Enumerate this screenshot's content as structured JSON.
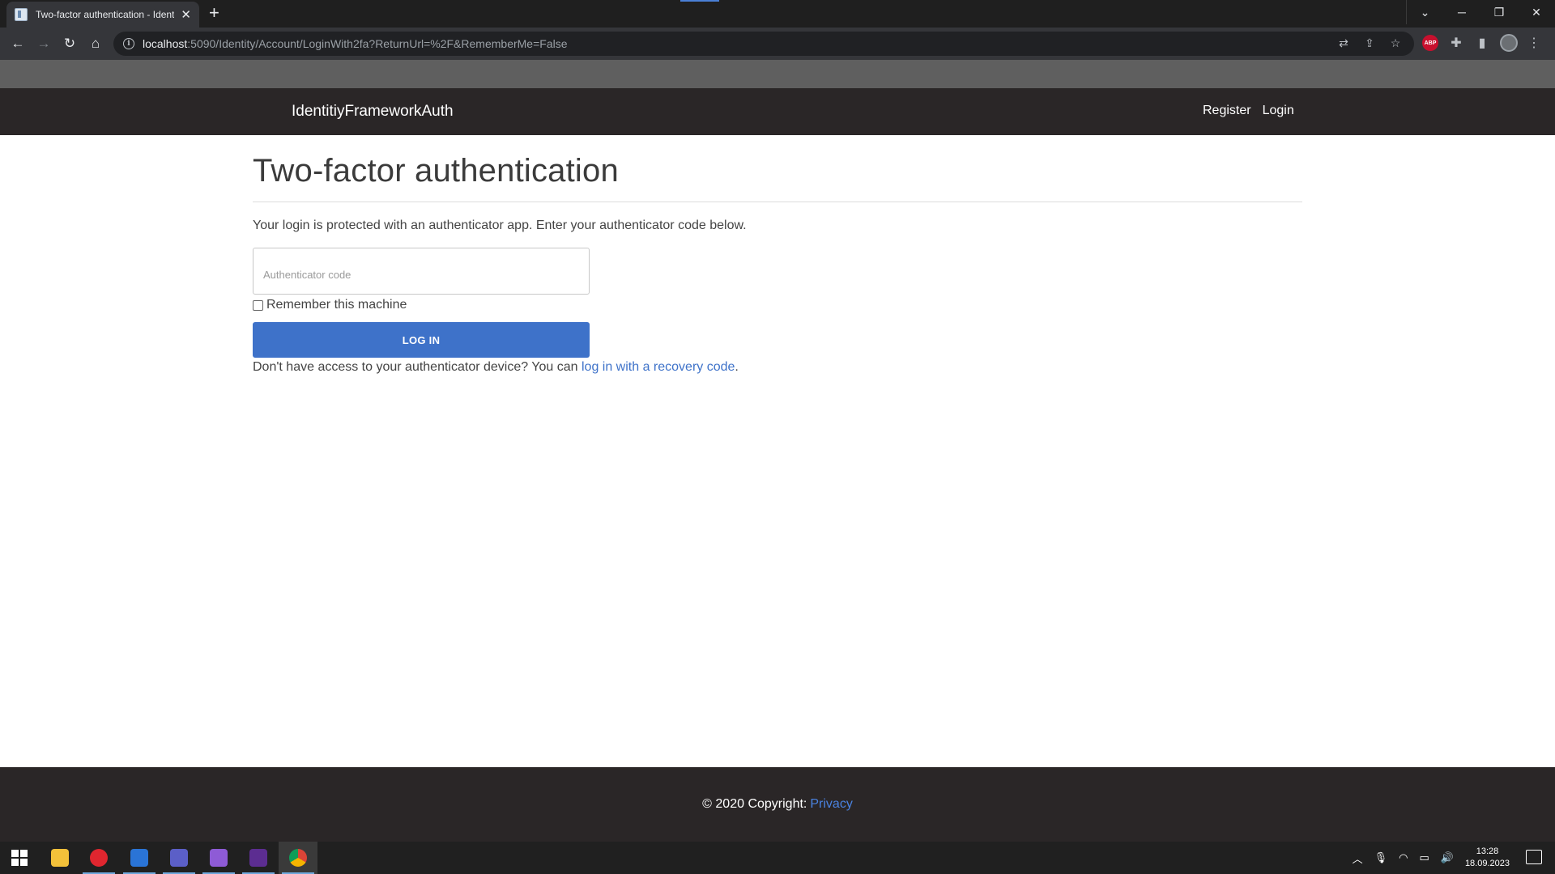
{
  "browser": {
    "tab_title": "Two-factor authentication - IdentitiyFrameworkAuth",
    "new_tab_symbol": "+",
    "close_tab_symbol": "✕",
    "url_host": "localhost",
    "url_rest": ":5090/Identity/Account/LoginWith2fa?ReturnUrl=%2F&RememberMe=False",
    "extension_abp_label": "ABP",
    "window_controls": {
      "menu": "⌄",
      "minimize": "─",
      "restore": "❐",
      "close": "✕"
    },
    "nav_symbols": {
      "back": "←",
      "forward": "→",
      "reload": "↻",
      "home": "⌂"
    }
  },
  "navbar": {
    "brand": "IdentitiyFrameworkAuth",
    "links": [
      {
        "label": "Register"
      },
      {
        "label": "Login"
      }
    ]
  },
  "main": {
    "title": "Two-factor authentication",
    "lead": "Your login is protected with an authenticator app. Enter your authenticator code below.",
    "code_placeholder": "Authenticator code",
    "code_value": "",
    "remember_label": "Remember this machine",
    "remember_checked": false,
    "login_button": "LOG IN",
    "recovery_prefix": "Don't have access to your authenticator device? You can ",
    "recovery_link": "log in with a recovery code",
    "recovery_suffix": "."
  },
  "footer": {
    "copyright": "© 2020 Copyright:",
    "privacy_link": "Privacy"
  },
  "taskbar": {
    "apps": [
      {
        "name": "file-explorer-icon",
        "color": "#f3c13a"
      },
      {
        "name": "opera-icon",
        "color": "#e0262f"
      },
      {
        "name": "word-icon",
        "color": "#2a74d6"
      },
      {
        "name": "teams-icon",
        "color": "#5b5fc7"
      },
      {
        "name": "visual-studio-icon",
        "color": "#8e5bd6"
      },
      {
        "name": "terminal-icon",
        "color": "#5c2d91"
      },
      {
        "name": "chrome-icon",
        "color": "#e7b51d"
      }
    ],
    "clock_time": "13:28",
    "clock_date": "18.09.2023"
  },
  "colors": {
    "navbar_bg": "#2a2627",
    "accent": "#3e72c9",
    "footer_link": "#4a82e0"
  }
}
